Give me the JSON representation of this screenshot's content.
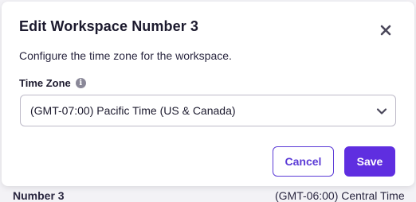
{
  "background": {
    "left_text": "Number 3",
    "right_text": "(GMT-06:00) Central Time"
  },
  "modal": {
    "title": "Edit Workspace Number 3",
    "description": "Configure the time zone for the workspace.",
    "field_label": "Time Zone",
    "info_icon_glyph": "i",
    "select_value": "(GMT-07:00) Pacific Time (US & Canada)",
    "cancel_label": "Cancel",
    "save_label": "Save"
  },
  "icons": {
    "close": "close-icon",
    "info": "info-icon",
    "chevron": "chevron-down-icon"
  },
  "colors": {
    "accent": "#5f2ee0",
    "text": "#1c1a2e",
    "border": "#bdbac8"
  }
}
